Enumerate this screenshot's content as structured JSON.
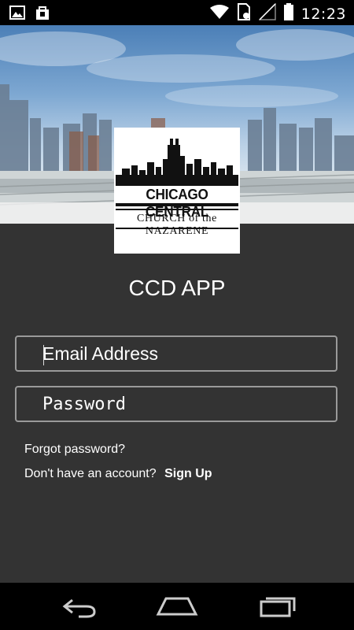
{
  "status_bar": {
    "time": "12:23",
    "icons": [
      "gallery-icon",
      "shopping-bag-icon",
      "wifi-icon",
      "sim-icon",
      "signal-icon",
      "battery-icon"
    ]
  },
  "logo": {
    "line1": "CHICAGO CENTRAL",
    "line2": "CHURCH of the NAZARENE"
  },
  "app": {
    "title": "CCD APP"
  },
  "form": {
    "email_placeholder": "Email Address",
    "password_placeholder": "Password"
  },
  "links": {
    "forgot": "Forgot password?",
    "no_account": "Don't have an account?",
    "signup": "Sign Up"
  },
  "navbar": {
    "icons": [
      "back-icon",
      "home-icon",
      "recents-icon"
    ]
  }
}
